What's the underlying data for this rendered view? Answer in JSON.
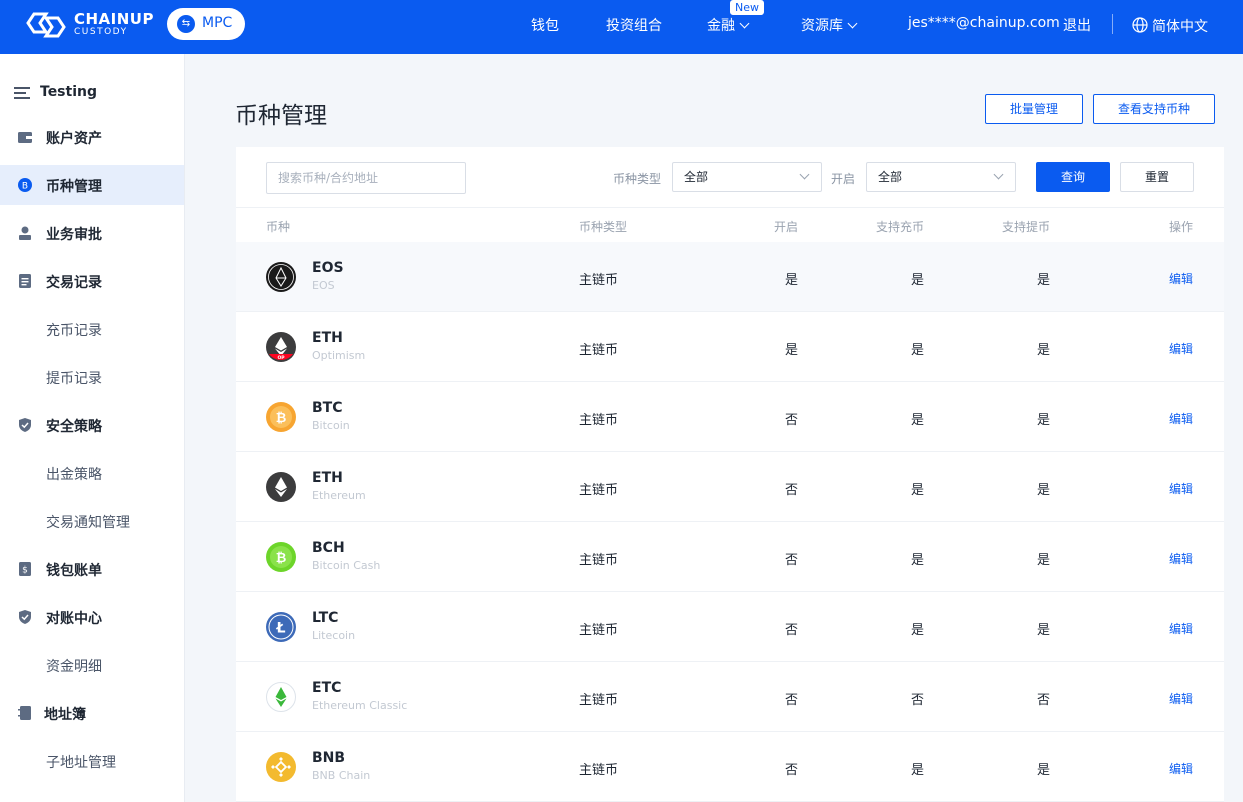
{
  "header": {
    "brand_top": "CHAINUP",
    "brand_bottom": "CUSTODY",
    "mpc_label": "MPC",
    "nav": {
      "wallet": "钱包",
      "portfolio": "投资组合",
      "finance": "金融",
      "finance_badge": "New",
      "resources": "资源库",
      "email": "jes****@chainup.com",
      "logout": "退出",
      "language": "简体中文"
    }
  },
  "sidebar": {
    "title": "Testing",
    "items": [
      {
        "label": "账户资产",
        "icon": "wallet-icon"
      },
      {
        "label": "币种管理",
        "icon": "coin-icon",
        "active": true
      },
      {
        "label": "业务审批",
        "icon": "user-icon"
      },
      {
        "label": "交易记录",
        "icon": "document-icon"
      },
      {
        "label": "充币记录",
        "sub": true
      },
      {
        "label": "提币记录",
        "sub": true
      },
      {
        "label": "安全策略",
        "icon": "shield-icon"
      },
      {
        "label": "出金策略",
        "sub": true
      },
      {
        "label": "交易通知管理",
        "sub": true
      },
      {
        "label": "钱包账单",
        "icon": "bill-icon"
      },
      {
        "label": "对账中心",
        "icon": "shield-check-icon"
      },
      {
        "label": "资金明细",
        "sub": true
      },
      {
        "label": "地址簿",
        "icon": "address-book-icon"
      },
      {
        "label": "子地址管理",
        "sub": true
      }
    ]
  },
  "main": {
    "title": "币种管理",
    "batch_button": "批量管理",
    "supported_button": "查看支持币种"
  },
  "filters": {
    "search_placeholder": "搜索币种/合约地址",
    "type_label": "币种类型",
    "type_value": "全部",
    "enabled_label": "开启",
    "enabled_value": "全部",
    "query_button": "查询",
    "reset_button": "重置"
  },
  "table": {
    "columns": {
      "coin": "币种",
      "type": "币种类型",
      "enabled": "开启",
      "deposit": "支持充币",
      "withdraw": "支持提币",
      "action": "操作"
    },
    "rows": [
      {
        "symbol": "EOS",
        "name": "EOS",
        "type": "主链币",
        "enabled": "是",
        "deposit": "是",
        "withdraw": "是",
        "action": "编辑",
        "icon": "eos-icon"
      },
      {
        "symbol": "ETH",
        "name": "Optimism",
        "type": "主链币",
        "enabled": "是",
        "deposit": "是",
        "withdraw": "是",
        "action": "编辑",
        "icon": "eth-optimism-icon"
      },
      {
        "symbol": "BTC",
        "name": "Bitcoin",
        "type": "主链币",
        "enabled": "否",
        "deposit": "是",
        "withdraw": "是",
        "action": "编辑",
        "icon": "btc-icon"
      },
      {
        "symbol": "ETH",
        "name": "Ethereum",
        "type": "主链币",
        "enabled": "否",
        "deposit": "是",
        "withdraw": "是",
        "action": "编辑",
        "icon": "eth-icon"
      },
      {
        "symbol": "BCH",
        "name": "Bitcoin Cash",
        "type": "主链币",
        "enabled": "否",
        "deposit": "是",
        "withdraw": "是",
        "action": "编辑",
        "icon": "bch-icon"
      },
      {
        "symbol": "LTC",
        "name": "Litecoin",
        "type": "主链币",
        "enabled": "否",
        "deposit": "是",
        "withdraw": "是",
        "action": "编辑",
        "icon": "ltc-icon"
      },
      {
        "symbol": "ETC",
        "name": "Ethereum Classic",
        "type": "主链币",
        "enabled": "否",
        "deposit": "否",
        "withdraw": "否",
        "action": "编辑",
        "icon": "etc-icon"
      },
      {
        "symbol": "BNB",
        "name": "BNB Chain",
        "type": "主链币",
        "enabled": "否",
        "deposit": "是",
        "withdraw": "是",
        "action": "编辑",
        "icon": "bnb-icon"
      }
    ]
  },
  "colors": {
    "primary": "#0a5bf0",
    "sidebar_active": "#e6eefc",
    "btc": "#f7a531",
    "bch": "#6dd52a",
    "ltc": "#3d6ab8",
    "etc": "#3ab83a",
    "bnb": "#f3ba2f"
  }
}
